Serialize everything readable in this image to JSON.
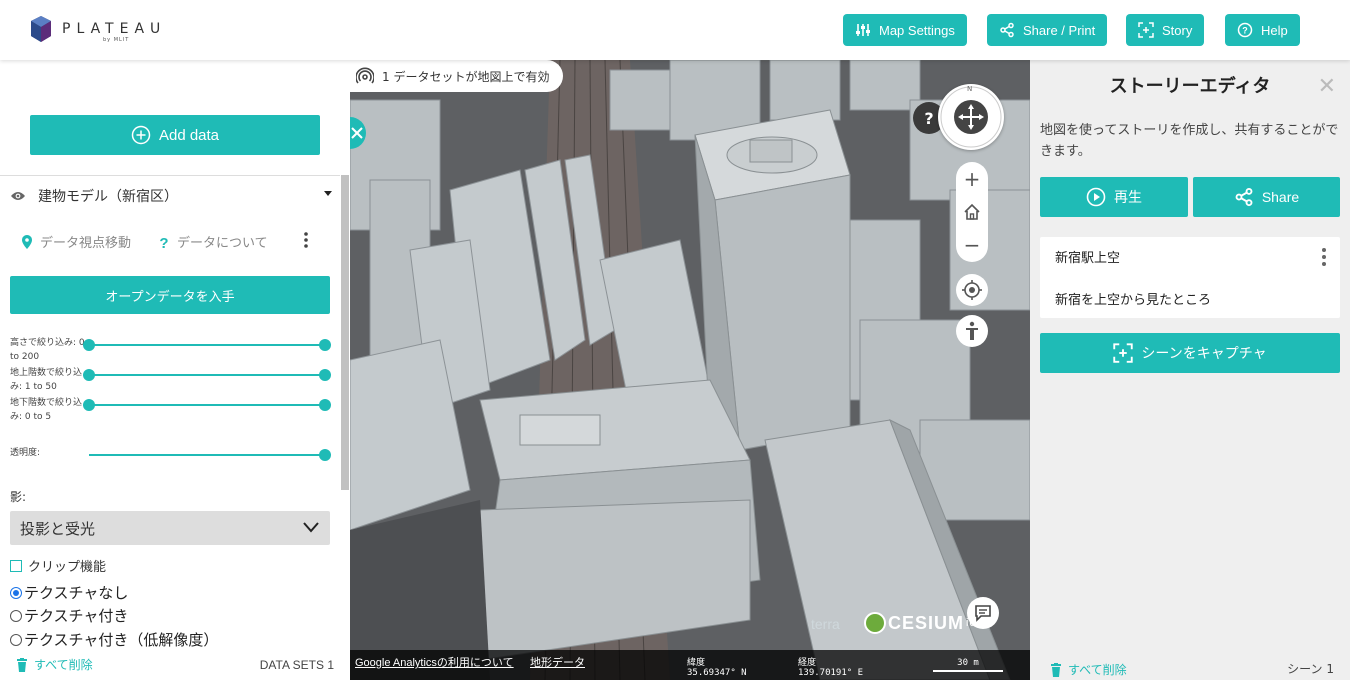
{
  "header": {
    "logo_text": "PLATEAU",
    "logo_sub": "by MLIT",
    "buttons": [
      {
        "label": "Map Settings",
        "icon": "sliders-icon"
      },
      {
        "label": "Share / Print",
        "icon": "share-icon"
      },
      {
        "label": "Story",
        "icon": "story-icon"
      },
      {
        "label": "Help",
        "icon": "help-icon"
      }
    ]
  },
  "left_panel": {
    "add_data_label": "Add data",
    "dataset": {
      "title": "建物モデル（新宿区）",
      "action_move": "データ視点移動",
      "action_about": "データについて",
      "open_data_label": "オープンデータを入手",
      "sliders": [
        {
          "label": "高さで絞り込み: 0 to 200",
          "low": 0,
          "high": 200
        },
        {
          "label": "地上階数で絞り込み: 1 to 50",
          "low": 1,
          "high": 50
        },
        {
          "label": "地下階数で絞り込み: 0 to 5",
          "low": 0,
          "high": 5
        },
        {
          "label": "透明度:",
          "value": 1.0
        }
      ],
      "shadow_label": "影:",
      "shadow_value": "投影と受光",
      "clip_label": "クリップ機能",
      "texture_options": [
        "テクスチャなし",
        "テクスチャ付き",
        "テクスチャ付き（低解像度）"
      ],
      "texture_selected": 0
    },
    "delete_all": "すべて削除",
    "dataset_count": "DATA SETS 1"
  },
  "map": {
    "notice": "1 データセットが地図上で有効",
    "help_label": "?",
    "compass_north": "N",
    "terra_label": "terra",
    "cesium_label": "CESIUM",
    "cesium_suffix": "ion",
    "analytics_link": "Google Analyticsの利用について",
    "terrain_link": "地形データ",
    "lat_label": "緯度",
    "lat_value": "35.69347° N",
    "lon_label": "経度",
    "lon_value": "139.70191° E",
    "scale_label": "30 m"
  },
  "right_panel": {
    "title": "ストーリーエディタ",
    "close_label": "✕",
    "description": "地図を使ってストーリを作成し、共有することができます。",
    "play_label": "再生",
    "share_label": "Share",
    "scene": {
      "title": "新宿駅上空",
      "description": "新宿を上空から見たところ"
    },
    "capture_label": "シーンをキャプチャ",
    "delete_all": "すべて削除",
    "scene_count": "シーン 1"
  },
  "colors": {
    "accent": "#1fbbb6",
    "building": "#c8cdd0",
    "ground": "#5a5d60"
  }
}
